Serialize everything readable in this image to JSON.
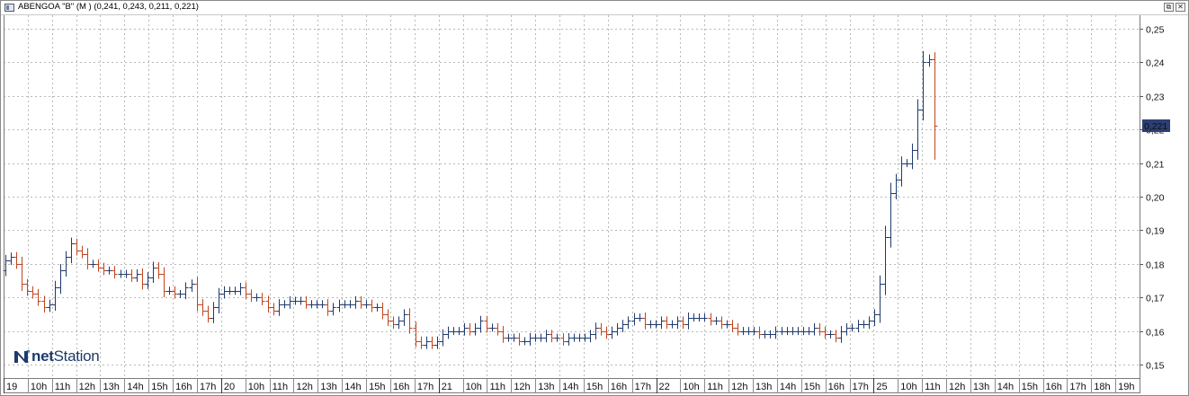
{
  "window": {
    "title": "ABENGOA \"B\" (M ) (0,241, 0,243, 0,211, 0,221)",
    "icon": "chart-window-icon",
    "restore_glyph": "⧉",
    "close_glyph": "✕"
  },
  "logo": {
    "part1": "net",
    "part2": "Station"
  },
  "chart_data": {
    "type": "ohlc",
    "title": "ABENGOA \"B\" (M ) (0,241, 0,243, 0,211, 0,221)",
    "ylim": [
      0.146,
      0.254
    ],
    "y_ticks": [
      0.15,
      0.16,
      0.17,
      0.18,
      0.19,
      0.2,
      0.21,
      0.22,
      0.23,
      0.24,
      0.25
    ],
    "y_tick_labels": [
      "0,15",
      "0,16",
      "0,17",
      "0,18",
      "0,19",
      "0,20",
      "0,21",
      "0,22",
      "0,23",
      "0,24",
      "0,25"
    ],
    "last_price": 0.221,
    "last_price_label": "0,221",
    "up_color": "#1f3a6e",
    "down_color": "#c0441e",
    "grid": true,
    "x_labels": [
      "19",
      "10h",
      "11h",
      "12h",
      "13h",
      "14h",
      "15h",
      "16h",
      "17h",
      "20",
      "10h",
      "11h",
      "12h",
      "13h",
      "14h",
      "15h",
      "16h",
      "17h",
      "21",
      "10h",
      "11h",
      "12h",
      "13h",
      "14h",
      "15h",
      "16h",
      "17h",
      "22",
      "10h",
      "11h",
      "12h",
      "13h",
      "14h",
      "15h",
      "16h",
      "17h",
      "25",
      "10h",
      "11h",
      "12h",
      "13h",
      "14h",
      "15h",
      "16h",
      "17h",
      "18h",
      "19h"
    ],
    "day_break_indices": [
      0,
      9,
      18,
      27,
      36
    ],
    "close": [
      0.181,
      0.182,
      0.18,
      0.174,
      0.172,
      0.171,
      0.169,
      0.167,
      0.168,
      0.173,
      0.178,
      0.182,
      0.186,
      0.184,
      0.183,
      0.18,
      0.18,
      0.179,
      0.178,
      0.178,
      0.177,
      0.177,
      0.177,
      0.176,
      0.177,
      0.174,
      0.176,
      0.179,
      0.177,
      0.172,
      0.172,
      0.171,
      0.171,
      0.173,
      0.174,
      0.168,
      0.166,
      0.164,
      0.167,
      0.171,
      0.172,
      0.172,
      0.172,
      0.173,
      0.171,
      0.17,
      0.17,
      0.169,
      0.167,
      0.166,
      0.168,
      0.168,
      0.169,
      0.169,
      0.169,
      0.168,
      0.168,
      0.168,
      0.168,
      0.166,
      0.167,
      0.168,
      0.168,
      0.168,
      0.169,
      0.168,
      0.168,
      0.167,
      0.167,
      0.165,
      0.163,
      0.162,
      0.163,
      0.165,
      0.161,
      0.157,
      0.156,
      0.157,
      0.156,
      0.157,
      0.159,
      0.16,
      0.16,
      0.16,
      0.161,
      0.16,
      0.161,
      0.163,
      0.161,
      0.161,
      0.16,
      0.158,
      0.158,
      0.158,
      0.157,
      0.157,
      0.158,
      0.158,
      0.158,
      0.159,
      0.158,
      0.158,
      0.157,
      0.158,
      0.158,
      0.158,
      0.158,
      0.159,
      0.161,
      0.16,
      0.159,
      0.16,
      0.161,
      0.162,
      0.163,
      0.164,
      0.164,
      0.162,
      0.162,
      0.162,
      0.163,
      0.162,
      0.162,
      0.163,
      0.162,
      0.164,
      0.164,
      0.164,
      0.164,
      0.163,
      0.163,
      0.162,
      0.162,
      0.161,
      0.16,
      0.16,
      0.16,
      0.16,
      0.159,
      0.159,
      0.159,
      0.16,
      0.16,
      0.16,
      0.16,
      0.16,
      0.16,
      0.16,
      0.161,
      0.16,
      0.159,
      0.159,
      0.158,
      0.16,
      0.161,
      0.161,
      0.162,
      0.162,
      0.163,
      0.165,
      0.174,
      0.188,
      0.201,
      0.205,
      0.21,
      0.21,
      0.214,
      0.226,
      0.24,
      0.241,
      0.221
    ]
  }
}
